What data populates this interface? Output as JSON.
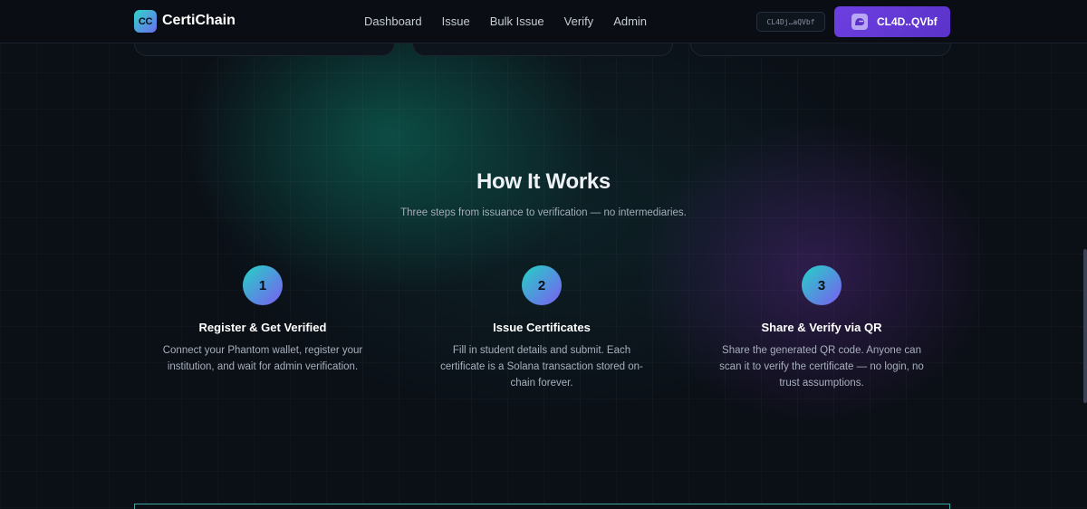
{
  "brand": {
    "logo_text": "CC",
    "name": "CertiChain"
  },
  "nav": {
    "links": [
      "Dashboard",
      "Issue",
      "Bulk Issue",
      "Verify",
      "Admin"
    ]
  },
  "wallet": {
    "address_chip": "CL4Dj…aQVbf",
    "button_label": "CL4D..QVbf",
    "icon": "phantom-ghost-icon"
  },
  "how_it_works": {
    "title": "How It Works",
    "subtitle": "Three steps from issuance to verification — no intermediaries.",
    "steps": [
      {
        "number": "1",
        "title": "Register & Get Verified",
        "description": "Connect your Phantom wallet, register your institution, and wait for admin verification."
      },
      {
        "number": "2",
        "title": "Issue Certificates",
        "description": "Fill in student details and submit. Each certificate is a Solana transaction stored on-chain forever."
      },
      {
        "number": "3",
        "title": "Share & Verify via QR",
        "description": "Share the generated QR code. Anyone can scan it to verify the certificate — no login, no trust assumptions."
      }
    ]
  },
  "colors": {
    "accent_teal": "#22d3c5",
    "accent_purple": "#6d3fe0",
    "background": "#0b0f16"
  }
}
